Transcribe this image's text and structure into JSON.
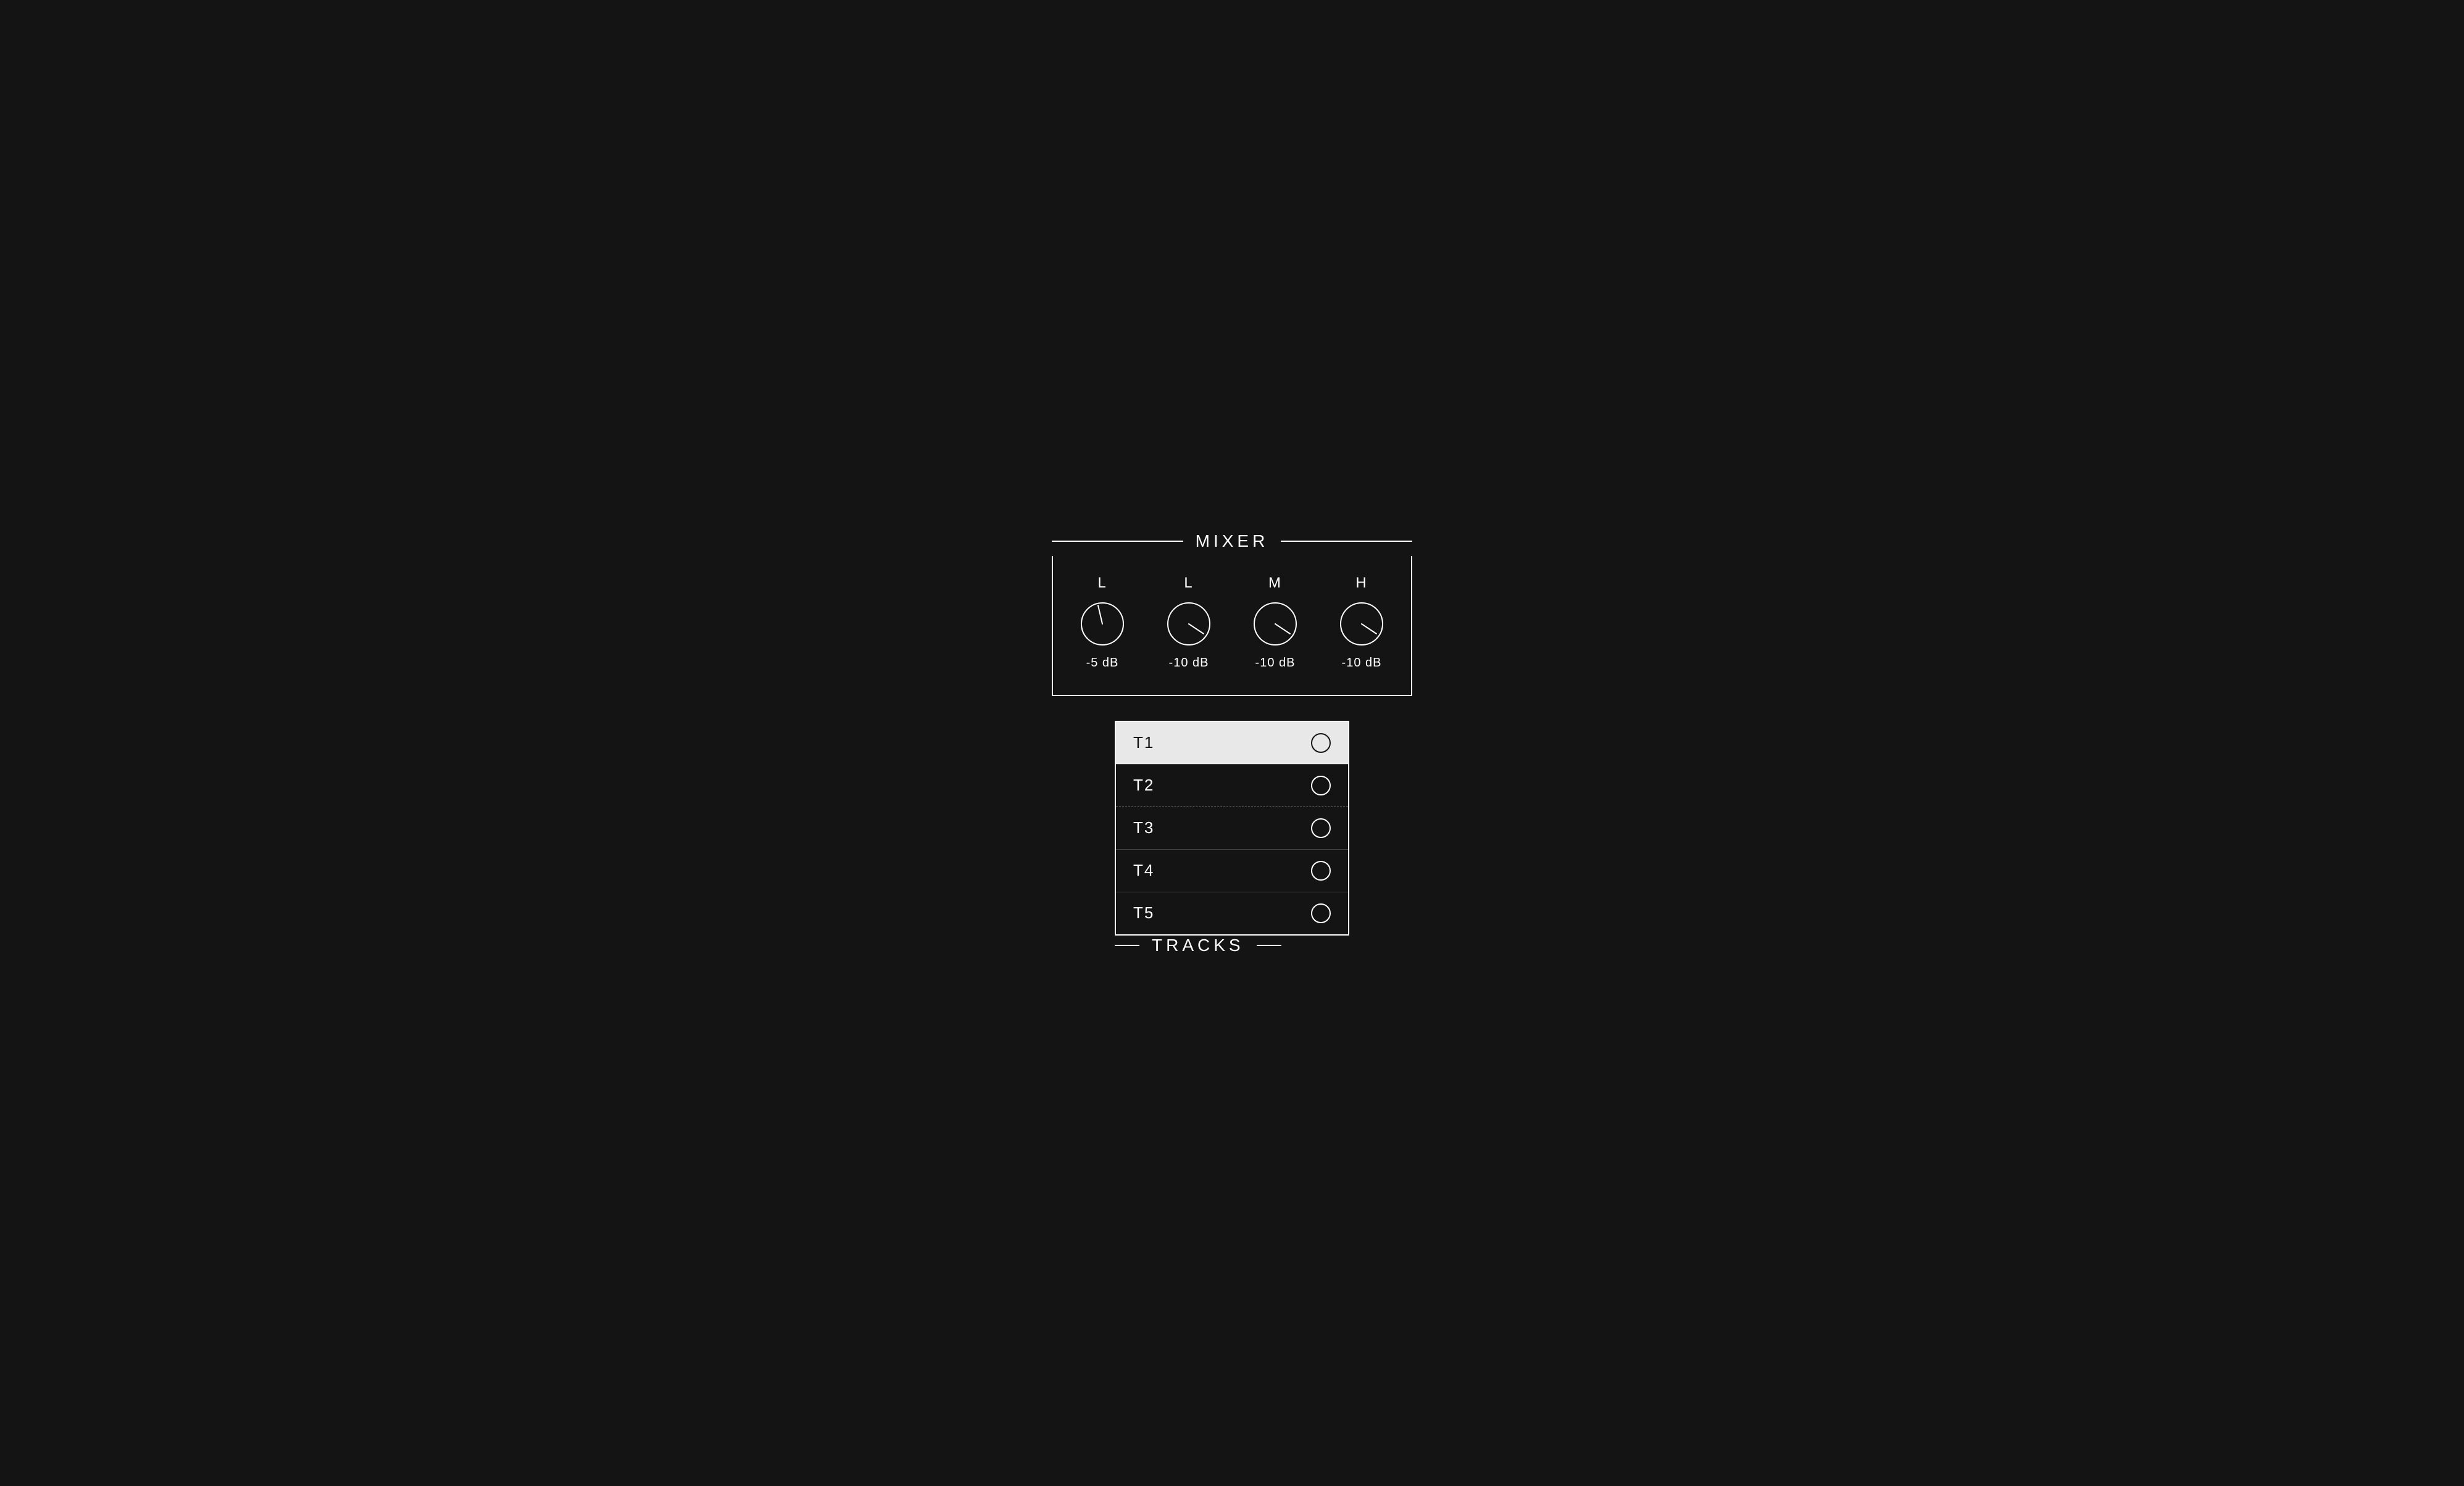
{
  "mixer": {
    "title": "MIXER",
    "knobs": [
      {
        "channel": "L",
        "value": "-5 dB",
        "angle": -20
      },
      {
        "channel": "L",
        "value": "-10 dB",
        "angle": -45
      },
      {
        "channel": "M",
        "value": "-10 dB",
        "angle": -45
      },
      {
        "channel": "H",
        "value": "-10 dB",
        "angle": -45
      }
    ]
  },
  "tracks": {
    "title": "TRACKS",
    "items": [
      {
        "label": "T1",
        "active": true
      },
      {
        "label": "T2",
        "active": false,
        "dashed": true
      },
      {
        "label": "T3",
        "active": false
      },
      {
        "label": "T4",
        "active": false
      },
      {
        "label": "T5",
        "active": false
      }
    ]
  },
  "colors": {
    "background": "#141414",
    "foreground": "#ffffff",
    "active_bg": "#e8e8e8"
  }
}
